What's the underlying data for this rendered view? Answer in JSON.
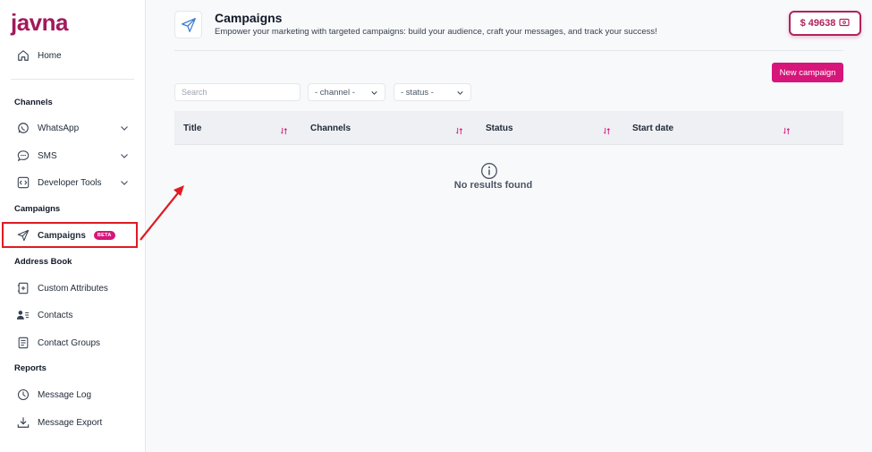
{
  "brand": {
    "logo_text": "javna",
    "color": "#a3195b"
  },
  "sidebar": {
    "home": {
      "label": "Home",
      "icon": "home-icon"
    },
    "sections": {
      "channels": "Channels",
      "campaigns": "Campaigns",
      "address_book": "Address Book",
      "reports": "Reports"
    },
    "items": [
      {
        "label": "WhatsApp",
        "icon": "whatsapp-icon",
        "expandable": true
      },
      {
        "label": "SMS",
        "icon": "sms-icon",
        "expandable": true
      },
      {
        "label": "Developer Tools",
        "icon": "code-icon",
        "expandable": true
      },
      {
        "label": "Campaigns",
        "icon": "send-icon",
        "badge": "BETA",
        "active": true
      },
      {
        "label": "Custom Attributes",
        "icon": "custom-attributes-icon"
      },
      {
        "label": "Contacts",
        "icon": "contacts-icon"
      },
      {
        "label": "Contact Groups",
        "icon": "contact-groups-icon"
      },
      {
        "label": "Message Log",
        "icon": "clock-icon"
      },
      {
        "label": "Message Export",
        "icon": "download-icon"
      }
    ]
  },
  "header": {
    "title": "Campaigns",
    "subtitle": "Empower your marketing with targeted campaigns: build your audience, craft your messages, and track your success!",
    "balance": "$ 49638"
  },
  "toolbar": {
    "new_campaign_label": "New campaign",
    "search_placeholder": "Search",
    "channel_select": "- channel -",
    "status_select": "- status -"
  },
  "table": {
    "columns": [
      "Title",
      "Channels",
      "Status",
      "Start date"
    ],
    "empty_text": "No results found"
  },
  "colors": {
    "accent": "#d6167a",
    "highlight": "#e01b22"
  }
}
